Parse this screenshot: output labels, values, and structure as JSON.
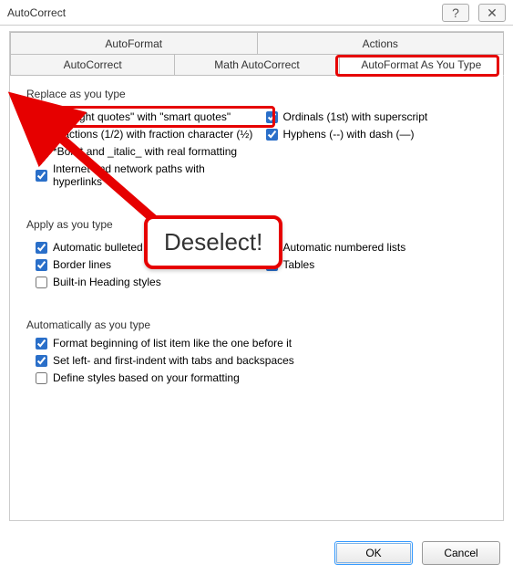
{
  "window": {
    "title": "AutoCorrect",
    "help_icon": "?",
    "close_icon": "✕"
  },
  "tabs_row1": [
    {
      "label": "AutoFormat"
    },
    {
      "label": "Actions"
    }
  ],
  "tabs_row2": [
    {
      "label": "AutoCorrect"
    },
    {
      "label": "Math AutoCorrect"
    },
    {
      "label": "AutoFormat As You Type"
    }
  ],
  "groups": {
    "replace": {
      "label": "Replace as you type",
      "left": [
        {
          "label": "\"Straight quotes\" with \"smart quotes\"",
          "checked": false
        },
        {
          "label": "Fractions (1/2) with fraction character (½)",
          "checked": true
        },
        {
          "label": "*Bold* and _italic_ with real formatting",
          "checked": false
        },
        {
          "label": "Internet and network paths with hyperlinks",
          "checked": true
        }
      ],
      "right": [
        {
          "label": "Ordinals (1st) with superscript",
          "checked": true
        },
        {
          "label": "Hyphens (--) with dash (—)",
          "checked": true
        }
      ]
    },
    "apply": {
      "label": "Apply as you type",
      "left": [
        {
          "label": "Automatic bulleted lists",
          "checked": true
        },
        {
          "label": "Border lines",
          "checked": true
        },
        {
          "label": "Built-in Heading styles",
          "checked": false
        }
      ],
      "right": [
        {
          "label": "Automatic numbered lists",
          "checked": true
        },
        {
          "label": "Tables",
          "checked": true
        }
      ]
    },
    "auto": {
      "label": "Automatically as you type",
      "items": [
        {
          "label": "Format beginning of list item like the one before it",
          "checked": true
        },
        {
          "label": "Set left- and first-indent with tabs and backspaces",
          "checked": true
        },
        {
          "label": "Define styles based on your formatting",
          "checked": false
        }
      ]
    }
  },
  "buttons": {
    "ok": "OK",
    "cancel": "Cancel"
  },
  "annotation": {
    "callout_text": "Deselect!"
  }
}
